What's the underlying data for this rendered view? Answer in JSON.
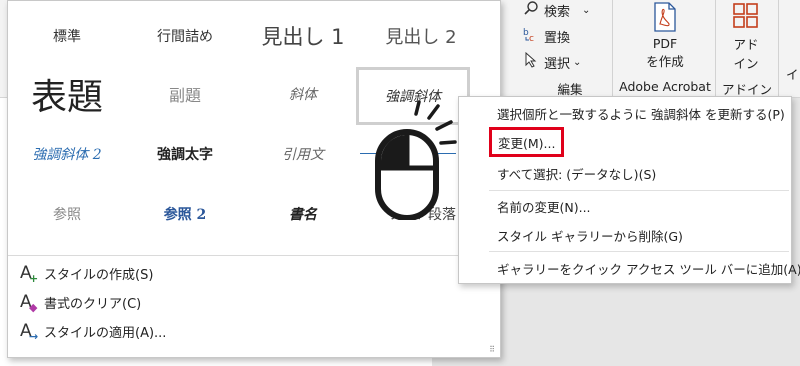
{
  "ribbon": {
    "search_label": "検索",
    "replace_label": "置換",
    "select_label": "選択",
    "edit_group_label": "編集",
    "pdf_button_line1": "PDF",
    "pdf_button_line2": "を作成",
    "adobe_group_label": "Adobe Acrobat",
    "addin_button_line1": "アド",
    "addin_button_line2": "イン",
    "addin_group_label": "アドイン",
    "cut_off_letter": "イ"
  },
  "gallery": {
    "styles": [
      {
        "label": "標準"
      },
      {
        "label": "行間詰め"
      },
      {
        "label": "見出し 1"
      },
      {
        "label": "見出し 2"
      },
      {
        "label": "表題"
      },
      {
        "label": "副題"
      },
      {
        "label": "斜体"
      },
      {
        "label": "強調斜体"
      },
      {
        "label": "強調斜体 2"
      },
      {
        "label": "強調太字"
      },
      {
        "label": "引用文"
      },
      {
        "label": "参照"
      },
      {
        "label": "参照 2"
      },
      {
        "label": "書名"
      },
      {
        "label": "リスト段落"
      }
    ],
    "commands": [
      {
        "label": "スタイルの作成(S)"
      },
      {
        "label": "書式のクリア(C)"
      },
      {
        "label": "スタイルの適用(A)..."
      }
    ]
  },
  "context_menu": {
    "items": [
      {
        "label": "選択個所と一致するように 強調斜体 を更新する(P)"
      },
      {
        "label": "変更(M)..."
      },
      {
        "label": "すべて選択: (データなし)(S)"
      },
      {
        "label": "名前の変更(N)..."
      },
      {
        "label": "スタイル ギャラリーから削除(G)"
      },
      {
        "label": "ギャラリーをクイック アクセス ツール バーに追加(A)"
      }
    ]
  },
  "colors": {
    "highlight_border": "#e0001a",
    "accent_blue": "#2b579a",
    "title_text": "#222222"
  },
  "icons": [
    "search-icon",
    "replace-icon",
    "select-cursor-icon",
    "pdf-icon",
    "addin-grid-icon",
    "mouse-click-icon",
    "style-icon"
  ]
}
